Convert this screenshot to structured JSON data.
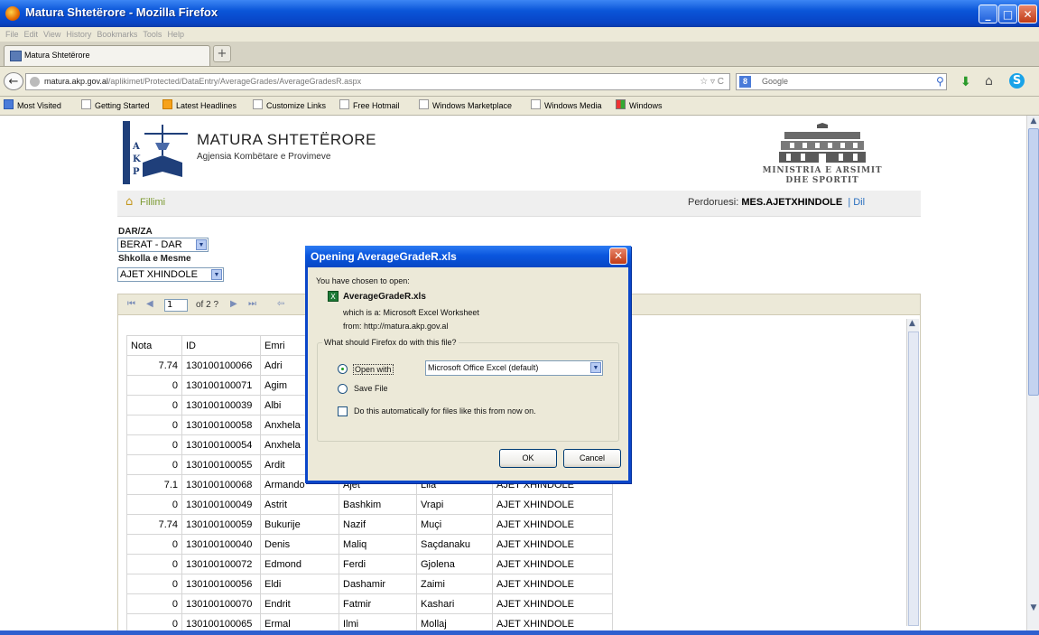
{
  "window": {
    "title": "Matura Shtetërore - Mozilla Firefox",
    "min_glyph": "_",
    "max_glyph": "□",
    "close_glyph": "✕"
  },
  "menu": [
    "File",
    "Edit",
    "View",
    "History",
    "Bookmarks",
    "Tools",
    "Help"
  ],
  "tab": {
    "label": "Matura Shtetërore",
    "new_tab": "+"
  },
  "nav": {
    "url_host": "matura.akp.gov.al",
    "url_path": "/aplikimet/Protected/DataEntry/AverageGrades/AverageGradesR.aspx",
    "url_icons": "☆ ▿ C",
    "search_engine": "8",
    "search_placeholder": "Google",
    "back_glyph": "←"
  },
  "bookmarks": [
    "Most Visited",
    "Getting Started",
    "Latest Headlines",
    "Customize Links",
    "Free Hotmail",
    "Windows Marketplace",
    "Windows Media",
    "Windows"
  ],
  "site": {
    "title": "MATURA SHTETËRORE",
    "subtitle": "Agjensia Kombëtare e Provimeve",
    "logo_letters": [
      "A",
      "K",
      "P"
    ],
    "ministry_line1": "MINISTRIA E ARSIMIT",
    "ministry_line2": "DHE SPORTIT",
    "home_label": "Fillimi",
    "user_label": "Perdoruesi:",
    "user_name": "MES.AJETXHINDOLE",
    "separator": "|",
    "logout_label": "Dil"
  },
  "filters": {
    "district_label": "DAR/ZA",
    "district_value": "BERAT - DAR",
    "school_label": "Shkolla e Mesme",
    "school_value": "AJET XHINDOLE"
  },
  "report": {
    "first": "⏮",
    "prev": "◀",
    "page": "1",
    "of_pages": "of 2 ?",
    "next": "▶",
    "last": "⏭",
    "back": "⇦"
  },
  "table": {
    "headers": [
      "Nota",
      "ID",
      "Emri"
    ],
    "rows": [
      [
        "7.74",
        "130100100066",
        "Adri",
        "",
        "",
        ""
      ],
      [
        "0",
        "130100100071",
        "Agim",
        "",
        "",
        ""
      ],
      [
        "0",
        "130100100039",
        "Albi",
        "",
        "",
        ""
      ],
      [
        "0",
        "130100100058",
        "Anxhela",
        "",
        "",
        ""
      ],
      [
        "0",
        "130100100054",
        "Anxhela",
        "",
        "",
        ""
      ],
      [
        "0",
        "130100100055",
        "Ardit",
        "",
        "",
        ""
      ],
      [
        "7.1",
        "130100100068",
        "Armando",
        "Ajet",
        "Lila",
        "AJET XHINDOLE"
      ],
      [
        "0",
        "130100100049",
        "Astrit",
        "Bashkim",
        "Vrapi",
        "AJET XHINDOLE"
      ],
      [
        "7.74",
        "130100100059",
        "Bukurije",
        "Nazif",
        "Muçi",
        "AJET XHINDOLE"
      ],
      [
        "0",
        "130100100040",
        "Denis",
        "Maliq",
        "Saçdanaku",
        "AJET XHINDOLE"
      ],
      [
        "0",
        "130100100072",
        "Edmond",
        "Ferdi",
        "Gjolena",
        "AJET XHINDOLE"
      ],
      [
        "0",
        "130100100056",
        "Eldi",
        "Dashamir",
        "Zaimi",
        "AJET XHINDOLE"
      ],
      [
        "0",
        "130100100070",
        "Endrit",
        "Fatmir",
        "Kashari",
        "AJET XHINDOLE"
      ],
      [
        "0",
        "130100100065",
        "Ermal",
        "Ilmi",
        "Mollaj",
        "AJET XHINDOLE"
      ]
    ]
  },
  "dialog": {
    "title": "Opening AverageGradeR.xls",
    "close_glyph": "✕",
    "chosen": "You have chosen to open:",
    "file_name": "AverageGradeR.xls",
    "which_is": "which is a:  Microsoft Excel Worksheet",
    "from": "from:  http://matura.akp.gov.al",
    "question": "What should Firefox do with this file?",
    "open_with": "Open with",
    "app": "Microsoft Office Excel (default)",
    "save_file": "Save File",
    "auto": "Do this automatically for files like this from now on.",
    "ok": "OK",
    "cancel": "Cancel"
  }
}
